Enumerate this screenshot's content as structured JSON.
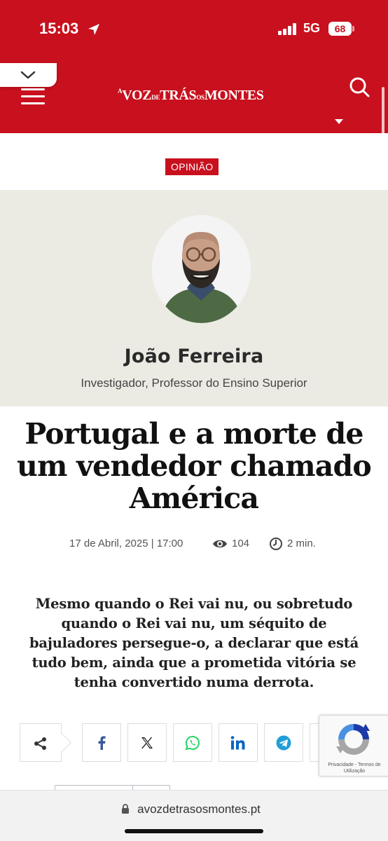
{
  "status_bar": {
    "time": "15:03",
    "network": "5G",
    "battery": "68"
  },
  "header": {
    "logo_text": "A VOZ DE TRÁS OS MONTES",
    "brand_color": "#c8101e"
  },
  "category": {
    "label": "OPINIÃO"
  },
  "author": {
    "name": "João Ferreira",
    "role": "Investigador, Professor do Ensino Superior"
  },
  "article": {
    "title": "Portugal e a morte de um vendedor chamado América",
    "date": "17 de Abril, 2025 | 17:00",
    "views": "104",
    "read_time": "2 min.",
    "lead": "Mesmo quando o Rei vai nu, ou sobretudo quando o Rei vai nu, um séquito de bajuladores persegue-o, a declarar que está tudo bem, ainda que a prometida vitória se tenha convertido numa derrota."
  },
  "share": {
    "buttons": [
      {
        "name": "facebook-icon",
        "color": "#3b5998"
      },
      {
        "name": "x-icon",
        "color": "#111111"
      },
      {
        "name": "whatsapp-icon",
        "color": "#25d366"
      },
      {
        "name": "linkedin-icon",
        "color": "#0a66c2"
      },
      {
        "name": "telegram-icon",
        "color": "#229ed9"
      }
    ]
  },
  "recaptcha": {
    "links": "Privacidade - Termos de Utilização"
  },
  "browser": {
    "url": "avozdetrasosmontes.pt"
  }
}
